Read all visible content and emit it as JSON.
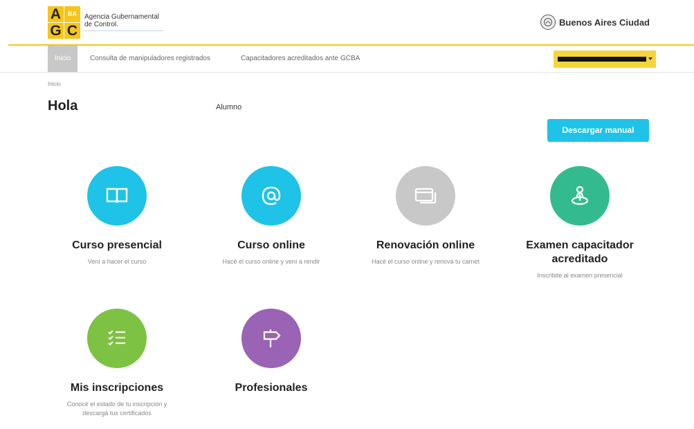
{
  "header": {
    "logo_letters": [
      "A",
      "BA",
      "G",
      "C"
    ],
    "org_name_line1": "Agencia Gubernamental",
    "org_name_line2": "de Control.",
    "city_name": "Buenos Aires Ciudad",
    "city_seal_icon": "city-seal-icon"
  },
  "nav": {
    "items": [
      {
        "label": "Inicio",
        "active": true
      },
      {
        "label": "Consulta de manipuladores registrados",
        "active": false
      },
      {
        "label": "Capacitadores acreditados ante GCBA",
        "active": false
      }
    ],
    "user_menu_redacted": true
  },
  "breadcrumb": "Inicio",
  "greeting": "Hola",
  "role": "Alumno",
  "download_button": "Descargar manual",
  "cards": [
    {
      "title": "Curso presencial",
      "subtitle": "Vení a hacer el curso",
      "color": "#1ec3e7",
      "icon": "book-icon"
    },
    {
      "title": "Curso online",
      "subtitle": "Hacé el curso online y vení a rendir",
      "color": "#1ec3e7",
      "icon": "at-sign-icon"
    },
    {
      "title": "Renovación online",
      "subtitle": "Hacé el curso online y renová tu carnet",
      "color": "#c8c8c8",
      "icon": "cards-icon"
    },
    {
      "title_line1": "Examen capacitador",
      "title_line2": "acreditado",
      "subtitle": "Inscribite al examen presencial",
      "color": "#33bb8f",
      "icon": "location-person-icon"
    },
    {
      "title": "Mis inscripciones",
      "subtitle_line1": "Conocé el estado de tu inscripción y",
      "subtitle_line2": "descargá tus certificados",
      "color": "#7dc242",
      "icon": "checklist-icon"
    },
    {
      "title": "Profesionales",
      "subtitle": "",
      "color": "#9a63b5",
      "icon": "signpost-icon"
    }
  ],
  "colors": {
    "brand_yellow": "#f6c519",
    "accent_blue": "#1ec3e7",
    "nav_active": "#c8c8c8"
  }
}
